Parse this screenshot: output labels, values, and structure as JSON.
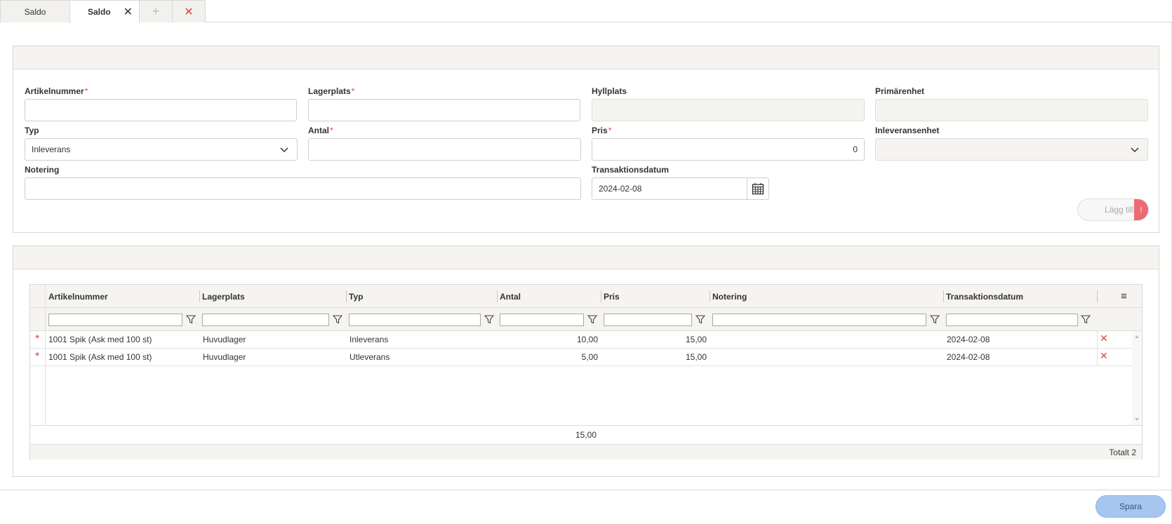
{
  "tabs": [
    {
      "label": "Saldo"
    },
    {
      "label": "Saldo"
    }
  ],
  "tab_actions": {
    "add": "+",
    "close_all": "✕",
    "close_tab": "✕"
  },
  "form": {
    "artikelnummer": {
      "label": "Artikelnummer",
      "value": ""
    },
    "lagerplats": {
      "label": "Lagerplats",
      "value": ""
    },
    "hyllplats": {
      "label": "Hyllplats",
      "value": ""
    },
    "primarenhet": {
      "label": "Primärenhet",
      "value": ""
    },
    "typ": {
      "label": "Typ",
      "value": "Inleverans"
    },
    "antal": {
      "label": "Antal",
      "value": ""
    },
    "pris": {
      "label": "Pris",
      "value": "0"
    },
    "inleveransenhet": {
      "label": "Inleveransenhet",
      "value": ""
    },
    "notering": {
      "label": "Notering",
      "value": ""
    },
    "transaktionsdatum": {
      "label": "Transaktionsdatum",
      "value": "2024-02-08"
    },
    "required_mark": "*",
    "add_button": "Lägg till",
    "add_warning": "!"
  },
  "grid": {
    "columns": [
      "Artikelnummer",
      "Lagerplats",
      "Typ",
      "Antal",
      "Pris",
      "Notering",
      "Transaktionsdatum"
    ],
    "rows": [
      {
        "artikelnummer": "1001 Spik (Ask med 100 st)",
        "lagerplats": "Huvudlager",
        "typ": "Inleverans",
        "antal": "10,00",
        "pris": "15,00",
        "notering": "",
        "datum": "2024-02-08"
      },
      {
        "artikelnummer": "1001 Spik (Ask med 100 st)",
        "lagerplats": "Huvudlager",
        "typ": "Utleverans",
        "antal": "5,00",
        "pris": "15,00",
        "notering": "",
        "datum": "2024-02-08"
      }
    ],
    "footer_antal_sum": "15,00",
    "total": "Totalt 2",
    "row_mark": "*",
    "row_delete": "✕",
    "menu_icon": "≡"
  },
  "save_button": "Spara",
  "colors": {
    "required": "#e0433a",
    "save_bg": "#a6c6f0",
    "warn_bg": "#ec6b72"
  }
}
